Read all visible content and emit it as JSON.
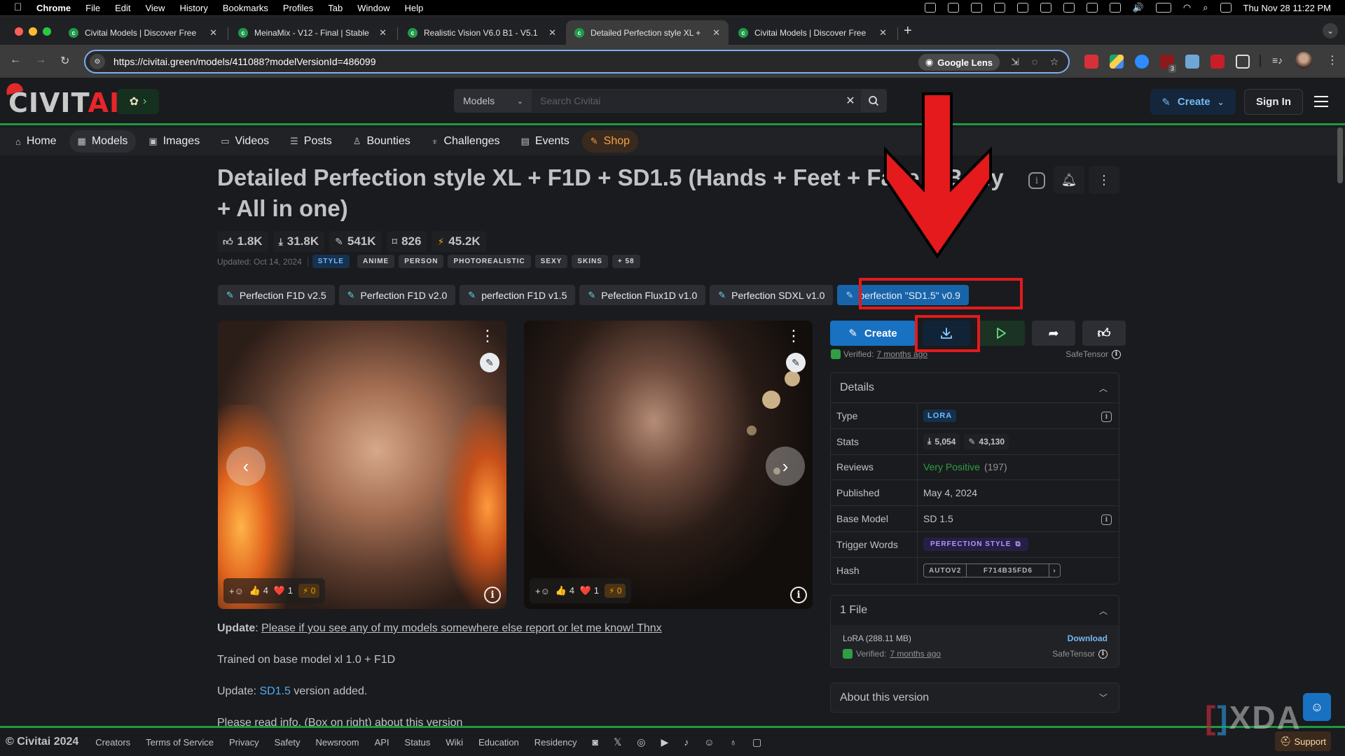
{
  "menubar": {
    "app": "Chrome",
    "items": [
      "File",
      "Edit",
      "View",
      "History",
      "Bookmarks",
      "Profiles",
      "Tab",
      "Window",
      "Help"
    ],
    "datetime": "Thu Nov 28  11:22 PM"
  },
  "browser": {
    "tabs": [
      {
        "title": "Civitai Models | Discover Free"
      },
      {
        "title": "MeinaMix - V12 - Final | Stable"
      },
      {
        "title": "Realistic Vision V6.0 B1 - V5.1"
      },
      {
        "title": "Detailed Perfection style XL +",
        "active": true
      },
      {
        "title": "Civitai Models | Discover Free"
      }
    ],
    "new_tab": "+",
    "url": "https://civitai.green/models/411088?modelVersionId=486099",
    "google_lens": "Google Lens",
    "extension_badge": "3"
  },
  "header": {
    "logo_a": "CIVIT",
    "logo_b": "AI",
    "search_scope": "Models",
    "search_placeholder": "Search Civitai",
    "create": "Create",
    "sign_in": "Sign In"
  },
  "nav": [
    {
      "label": "Home",
      "icon": "⌂"
    },
    {
      "label": "Models",
      "icon": "▦",
      "active": true
    },
    {
      "label": "Images",
      "icon": "▣"
    },
    {
      "label": "Videos",
      "icon": "▭"
    },
    {
      "label": "Posts",
      "icon": "☰"
    },
    {
      "label": "Bounties",
      "icon": "♙"
    },
    {
      "label": "Challenges",
      "icon": "♆"
    },
    {
      "label": "Events",
      "icon": "▤"
    },
    {
      "label": "Shop",
      "icon": "✎"
    }
  ],
  "model": {
    "title": "Detailed Perfection style XL + F1D + SD1.5 (Hands + Feet + Face + Body + All in one)",
    "stats": {
      "likes": "1.8K",
      "downloads": "31.8K",
      "generations": "541K",
      "bookmarks": "826",
      "buzz": "45.2K"
    },
    "updated": "Updated: Oct 14, 2024",
    "primary_tag": "STYLE",
    "tags": [
      "ANIME",
      "PERSON",
      "PHOTOREALISTIC",
      "SEXY",
      "SKINS"
    ],
    "more_tags": "+ 58",
    "versions": [
      "Perfection F1D v2.5",
      "Perfection F1D v2.0",
      "perfection F1D v1.5",
      "Pefection Flux1D v1.0",
      "Perfection SDXL v1.0",
      "perfection \"SD1.5\" v0.9"
    ],
    "active_version_index": 5
  },
  "gallery": [
    {
      "reactions": {
        "add": "+☺",
        "thumbs": "4",
        "hearts": "1",
        "buzz": "0"
      }
    },
    {
      "reactions": {
        "add": "+☺",
        "thumbs": "4",
        "hearts": "1",
        "buzz": "0"
      }
    }
  ],
  "description": {
    "p1_bold": "Update",
    "p1_link": "Please if you see any of my models somewhere else report or let me know! Thnx",
    "p2": "Trained on base model xl 1.0 + F1D",
    "p3_prefix": "Update: ",
    "p3_link": "SD1.5",
    "p3_suffix": " version added.",
    "p4": "Please read info. (Box on right) about this version"
  },
  "actions": {
    "create": "Create",
    "verified_label": "Verified:",
    "verified_when": "7 months ago",
    "format": "SafeTensor"
  },
  "details": {
    "title": "Details",
    "rows": {
      "type_label": "Type",
      "type": "LORA",
      "stats_label": "Stats",
      "downloads": "5,054",
      "generations": "43,130",
      "reviews_label": "Reviews",
      "reviews_sentiment": "Very Positive",
      "reviews_count": "(197)",
      "published_label": "Published",
      "published": "May 4, 2024",
      "base_label": "Base Model",
      "base": "SD 1.5",
      "trigger_label": "Trigger Words",
      "trigger": "PERFECTION STYLE",
      "hash_label": "Hash",
      "hash_type": "AUTOV2",
      "hash": "F714B35FD6"
    }
  },
  "files": {
    "title": "1 File",
    "name": "LoRA (288.11 MB)",
    "download": "Download",
    "verified_label": "Verified:",
    "verified_when": "7 months ago",
    "format": "SafeTensor"
  },
  "about": {
    "title": "About this version"
  },
  "footer": {
    "copyright": "© Civitai 2024",
    "links": [
      "Creators",
      "Terms of Service",
      "Privacy",
      "Safety",
      "Newsroom",
      "API",
      "Status",
      "Wiki",
      "Education",
      "Residency"
    ],
    "support": "Support"
  },
  "watermark": "XDA",
  "annotation_color": "#e41a1c"
}
